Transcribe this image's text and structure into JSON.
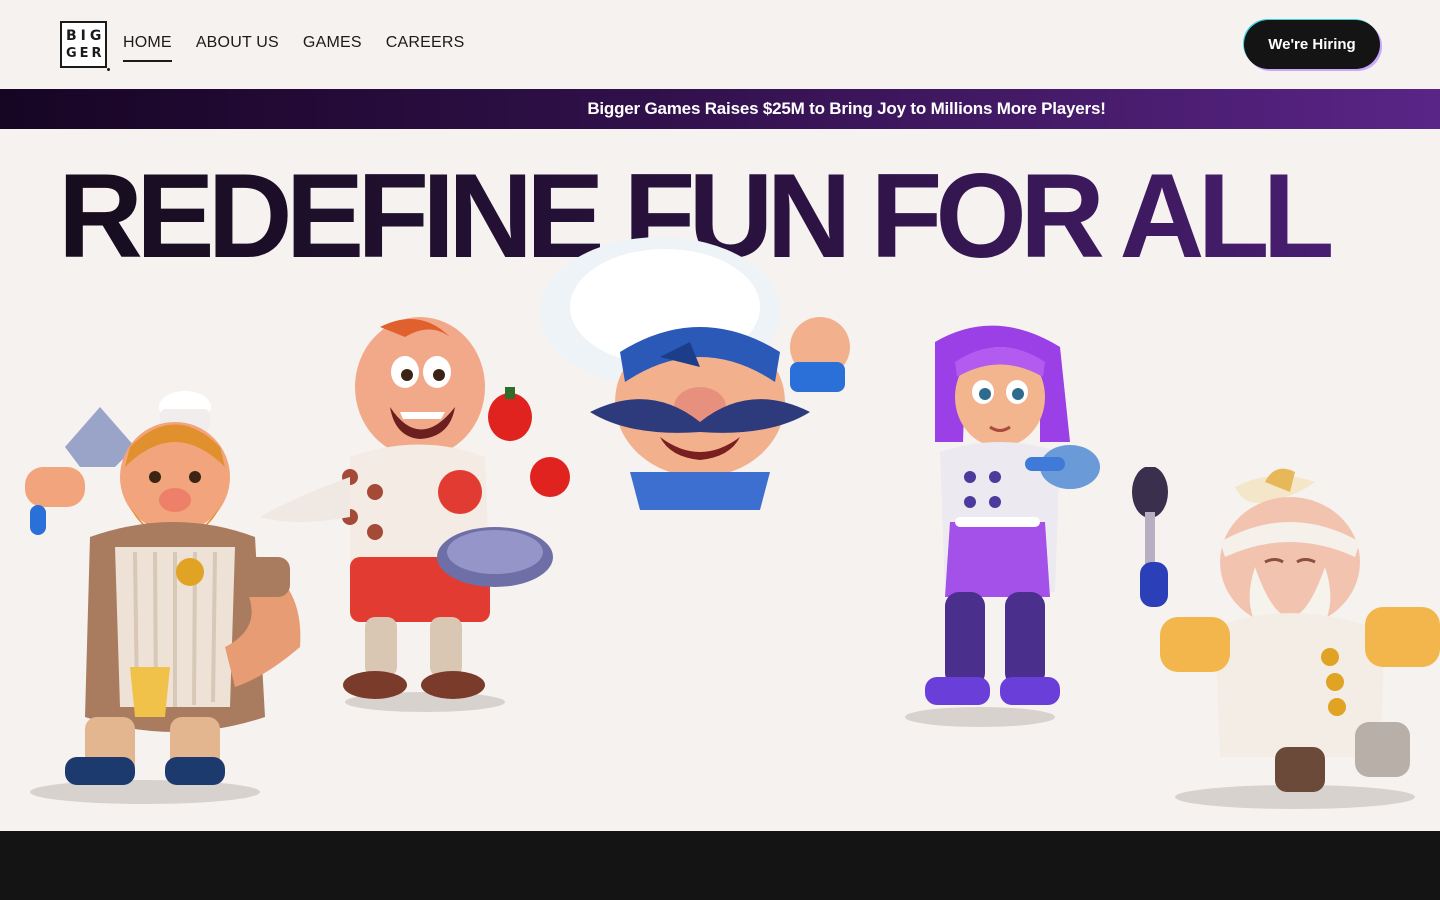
{
  "logo": {
    "line1": "BIG",
    "line2": "GER"
  },
  "nav": {
    "items": [
      {
        "label": "HOME",
        "active": true
      },
      {
        "label": "ABOUT US",
        "active": false
      },
      {
        "label": "GAMES",
        "active": false
      },
      {
        "label": "CAREERS",
        "active": false
      }
    ]
  },
  "header": {
    "cta_label": "We're Hiring"
  },
  "banner": {
    "text": "Bigger Games Raises $25M to Bring Joy to Millions More Players!"
  },
  "hero": {
    "title": "REDEFINE FUN FOR ALL"
  },
  "colors": {
    "background": "#f6f2ef",
    "title_dark": "#160d1e",
    "title_purple": "#4a1f74",
    "banner_start": "#170524",
    "banner_end": "#5a2587",
    "button": "#141414",
    "footer_band": "#141414"
  },
  "characters": [
    {
      "name": "chef-knight-character"
    },
    {
      "name": "juggling-chef-character"
    },
    {
      "name": "mustache-chef-character"
    },
    {
      "name": "purple-hair-chef-character"
    },
    {
      "name": "old-chef-character"
    }
  ]
}
